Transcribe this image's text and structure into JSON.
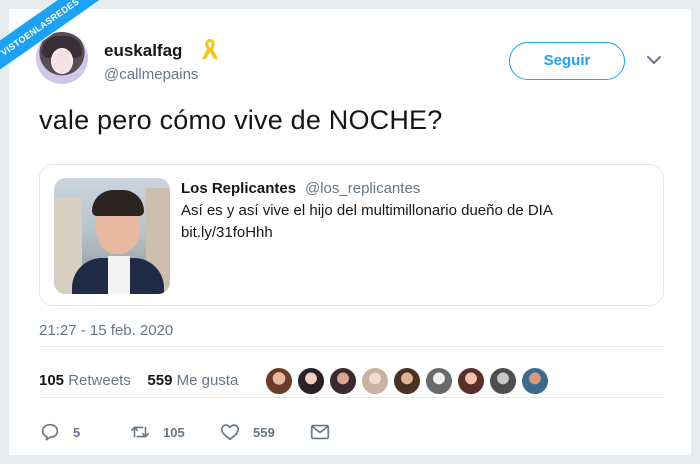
{
  "watermark": "VISTOENLASREDES",
  "author": {
    "name": "euskalfag",
    "handle": "@callmepains",
    "badge_icon": "yellow-ribbon-icon"
  },
  "follow_label": "Seguir",
  "tweet_text": "vale pero cómo vive de NOCHE?",
  "quoted": {
    "name": "Los Replicantes",
    "handle": "@los_replicantes",
    "text": "Así es y así vive el hijo del multimillonario dueño de DIA",
    "link": "bit.ly/31foHhh"
  },
  "timestamp": "21:27 - 15 feb. 2020",
  "stats": {
    "retweets_count": "105",
    "retweets_label": "Retweets",
    "likes_count": "559",
    "likes_label": "Me gusta"
  },
  "actions": {
    "reply_count": "5",
    "retweet_count": "105",
    "like_count": "559"
  },
  "colors": {
    "accent": "#1da1f2",
    "muted": "#657786",
    "ribbon": "#f4c51c"
  },
  "liker_avatars": [
    "avatar-1",
    "avatar-2",
    "avatar-3",
    "avatar-4",
    "avatar-5",
    "avatar-6",
    "avatar-7",
    "avatar-8",
    "avatar-9"
  ]
}
